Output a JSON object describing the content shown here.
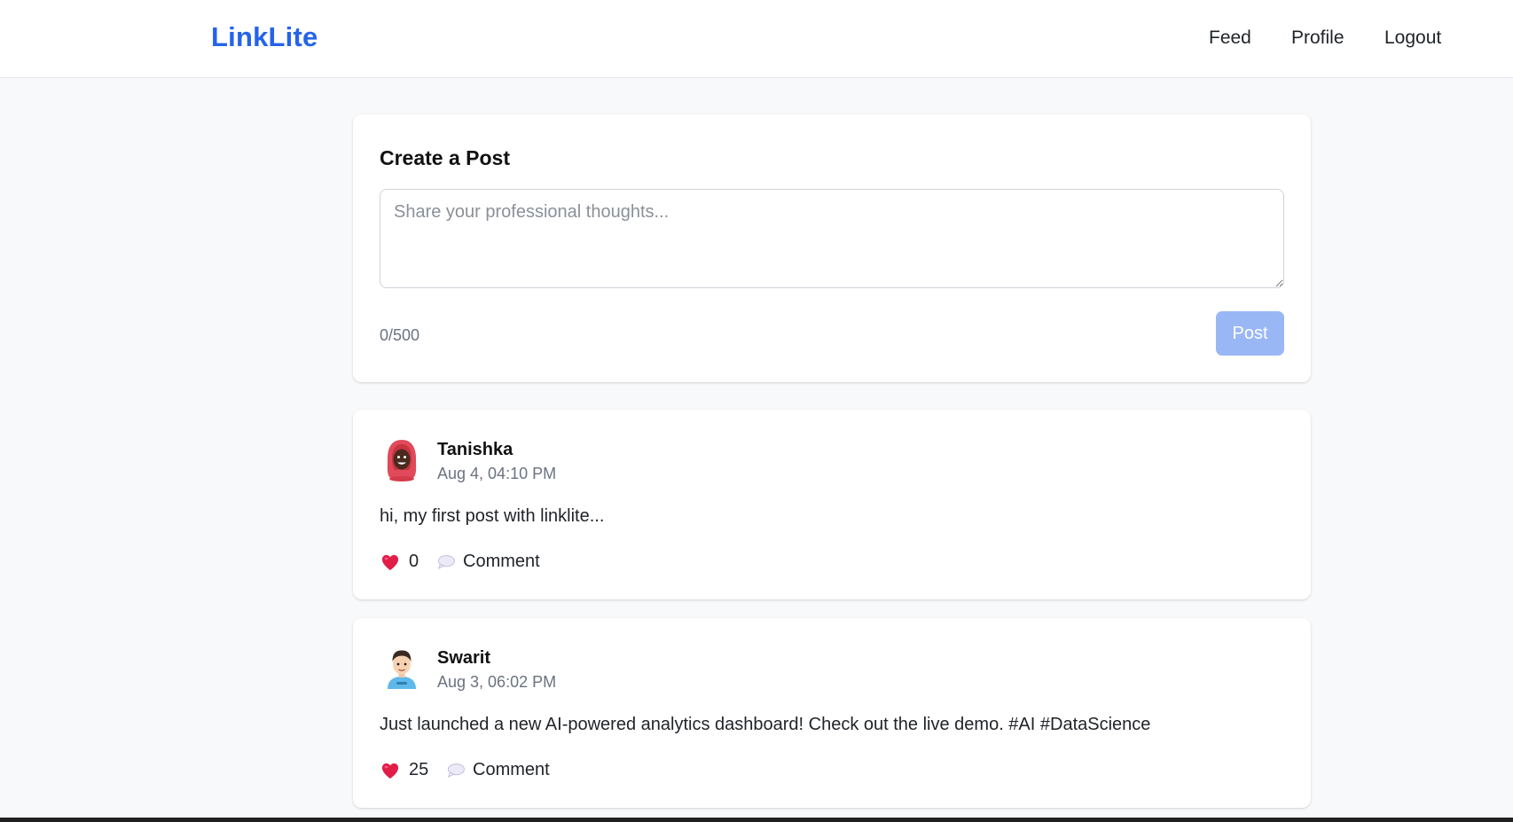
{
  "navbar": {
    "brand": "LinkLite",
    "links": [
      "Feed",
      "Profile",
      "Logout"
    ]
  },
  "composer": {
    "title": "Create a Post",
    "placeholder": "Share your professional thoughts...",
    "value": "",
    "char_count": "0/500",
    "post_label": "Post"
  },
  "posts": [
    {
      "author": "Tanishka",
      "time": "Aug 4, 04:10 PM",
      "body": "hi, my first post with linklite...",
      "likes": "0",
      "comment_label": "Comment",
      "avatar_icon": "woman-hijab-avatar-icon"
    },
    {
      "author": "Swarit",
      "time": "Aug 3, 06:02 PM",
      "body": "Just launched a new AI-powered analytics dashboard! Check out the live demo. #AI #DataScience",
      "likes": "25",
      "comment_label": "Comment",
      "avatar_icon": "man-avatar-icon"
    }
  ],
  "colors": {
    "brand": "#2563eb",
    "post_button_disabled": "#9ab7f5",
    "heart": "#e11d48",
    "background": "#f8f9fa"
  }
}
